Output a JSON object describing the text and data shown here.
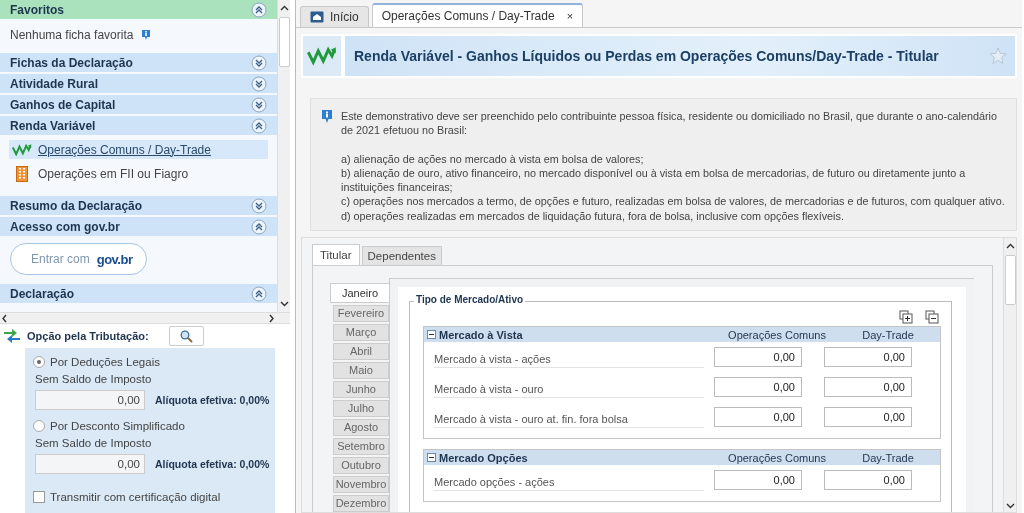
{
  "sidebar": {
    "sections": [
      {
        "title": "Favoritos",
        "kind": "favorites",
        "expanded": true,
        "text": "Nenhuma ficha favorita"
      },
      {
        "title": "Fichas da Declaração",
        "kind": "plain",
        "expanded": false
      },
      {
        "title": "Atividade Rural",
        "kind": "plain",
        "expanded": false
      },
      {
        "title": "Ganhos de Capital",
        "kind": "plain",
        "expanded": false
      },
      {
        "title": "Renda Variável",
        "kind": "links",
        "expanded": true,
        "items": [
          {
            "label": "Operações Comuns / Day-Trade",
            "selected": true
          },
          {
            "label": "Operações em FII ou Fiagro",
            "selected": false
          }
        ]
      },
      {
        "title": "Resumo da Declaração",
        "kind": "plain",
        "expanded": false
      },
      {
        "title": "Acesso com gov.br",
        "kind": "login",
        "expanded": true,
        "button": {
          "label": "Entrar com",
          "brand": "gov.br"
        }
      },
      {
        "title": "Declaração",
        "kind": "plain",
        "expanded": true
      }
    ]
  },
  "taxation": {
    "title": "Opção pela Tributação:",
    "options": [
      {
        "label": "Por Deduções Legais",
        "selected": true,
        "sublabel": "Sem Saldo de Imposto",
        "value": "0,00",
        "rate": "Alíquota efetiva: 0,00%"
      },
      {
        "label": "Por Desconto Simplificado",
        "selected": false,
        "sublabel": "Sem Saldo de Imposto",
        "value": "0,00",
        "rate": "Alíquota efetiva: 0,00%"
      }
    ],
    "certificate": {
      "label": "Transmitir com certificação digital",
      "checked": false
    }
  },
  "tabs": [
    {
      "label": "Início",
      "selected": false,
      "closable": false
    },
    {
      "label": "Operações Comuns / Day-Trade",
      "selected": true,
      "closable": true,
      "close": "×"
    }
  ],
  "header": {
    "title": "Renda Variável - Ganhos Líquidos ou Perdas em Operações Comuns/Day-Trade - Titular",
    "favorite": false
  },
  "info": {
    "paragraphs": [
      "Este demonstrativo deve ser preenchido pelo contribuinte pessoa física, residente ou domiciliado no Brasil, que durante o ano-calendário de 2021 efetuou no Brasil:",
      "a) alienação de ações no mercado à vista em bolsa de valores;",
      "b) alienação de ouro, ativo financeiro, no mercado disponível ou à vista em bolsa de mercadorias, de futuro ou diretamente junto a instituições financeiras;",
      "c) operações nos mercados a termo, de opções e futuro, realizadas em bolsa de valores, de mercadorias e de futuros, com qualquer ativo.",
      "d) operações realizadas em mercados de liquidação futura, fora de bolsa, inclusive com opções flexíveis."
    ]
  },
  "subtabs": [
    {
      "label": "Titular",
      "selected": true
    },
    {
      "label": "Dependentes",
      "selected": false
    }
  ],
  "months": [
    {
      "label": "Janeiro",
      "selected": true
    },
    {
      "label": "Fevereiro",
      "selected": false
    },
    {
      "label": "Março",
      "selected": false
    },
    {
      "label": "Abril",
      "selected": false
    },
    {
      "label": "Maio",
      "selected": false
    },
    {
      "label": "Junho",
      "selected": false
    },
    {
      "label": "Julho",
      "selected": false
    },
    {
      "label": "Agosto",
      "selected": false
    },
    {
      "label": "Setembro",
      "selected": false
    },
    {
      "label": "Outubro",
      "selected": false
    },
    {
      "label": "Novembro",
      "selected": false
    },
    {
      "label": "Dezembro",
      "selected": false
    }
  ],
  "fieldset": {
    "title": "Tipo de Mercado/Ativo",
    "groups": [
      {
        "title": "Mercado à Vista",
        "expanded": true,
        "columns": [
          "Operações Comuns",
          "Day-Trade"
        ],
        "rows": [
          {
            "label": "Mercado à vista - ações",
            "values": [
              "0,00",
              "0,00"
            ]
          },
          {
            "label": "Mercado à vista - ouro",
            "values": [
              "0,00",
              "0,00"
            ]
          },
          {
            "label": "Mercado à vista - ouro at. fin. fora bolsa",
            "values": [
              "0,00",
              "0,00"
            ]
          }
        ]
      },
      {
        "title": "Mercado Opções",
        "expanded": true,
        "columns": [
          "Operações Comuns",
          "Day-Trade"
        ],
        "rows": [
          {
            "label": "Mercado opções - ações",
            "values": [
              "0,00",
              "0,00"
            ]
          }
        ]
      }
    ]
  }
}
